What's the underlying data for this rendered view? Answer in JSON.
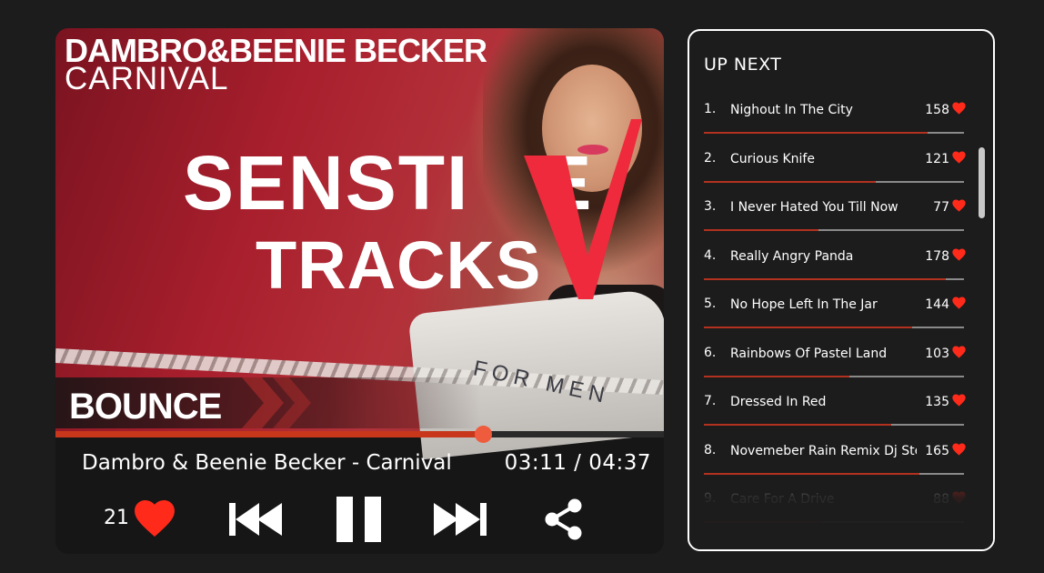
{
  "player": {
    "artist_heading": "DAMBRO&BEENIE BECKER",
    "track_heading": "CARNIVAL",
    "logo_line1": "SENSTI",
    "logo_line1_tail": "E",
    "logo_line2": "TRACKS",
    "shirt_text": "FOR MEN",
    "genre": "BOUNCE",
    "progress": 0.703,
    "now_playing": "Dambro & Beenie Becker - Carnival",
    "time": "03:11 / 04:37",
    "likes": "21",
    "colors": {
      "accent": "#c8371b",
      "heart": "#ff2a1a",
      "knob": "#ef5b3d"
    },
    "icons": [
      "heart-icon",
      "previous-icon",
      "pause-icon",
      "next-icon",
      "share-icon"
    ]
  },
  "up_next": {
    "title": "UP NEXT",
    "items": [
      {
        "num": "1.",
        "name": "Nighout In The City",
        "count": "158",
        "progress": 0.86
      },
      {
        "num": "2.",
        "name": "Curious Knife",
        "count": "121",
        "progress": 0.66
      },
      {
        "num": "3.",
        "name": "I Never Hated You Till Now",
        "count": "77",
        "progress": 0.44
      },
      {
        "num": "4.",
        "name": "Really Angry Panda",
        "count": "178",
        "progress": 0.93
      },
      {
        "num": "5.",
        "name": "No Hope Left In The Jar",
        "count": "144",
        "progress": 0.8
      },
      {
        "num": "6.",
        "name": "Rainbows Of Pastel Land",
        "count": "103",
        "progress": 0.56
      },
      {
        "num": "7.",
        "name": "Dressed In Red",
        "count": "135",
        "progress": 0.72
      },
      {
        "num": "8.",
        "name": "Novemeber Rain Remix Dj Steel",
        "count": "165",
        "progress": 0.83
      },
      {
        "num": "9.",
        "name": "Care For  A Drive",
        "count": "88",
        "progress": 0.45
      }
    ]
  }
}
